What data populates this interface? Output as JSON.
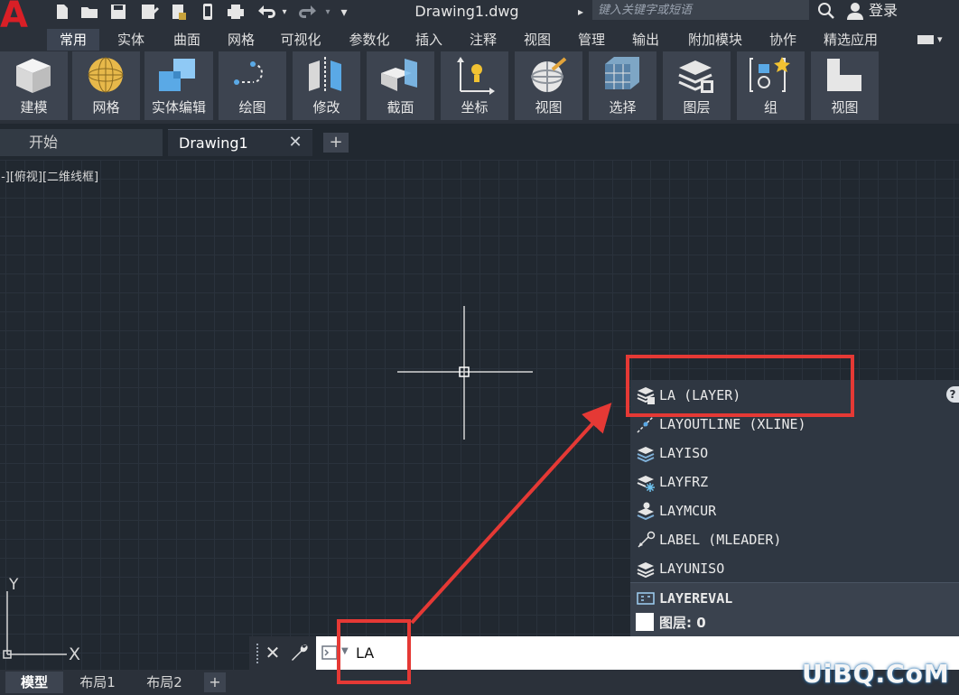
{
  "app": {
    "document_title": "Drawing1.dwg",
    "search_placeholder": "键入关键字或短语",
    "login_label": "登录",
    "logo_letter": "A",
    "accent_color": "#d91f26"
  },
  "ribbon_tabs": [
    {
      "label": "常用",
      "active": true
    },
    {
      "label": "实体"
    },
    {
      "label": "曲面"
    },
    {
      "label": "网格"
    },
    {
      "label": "可视化"
    },
    {
      "label": "参数化"
    },
    {
      "label": "插入"
    },
    {
      "label": "注释"
    },
    {
      "label": "视图"
    },
    {
      "label": "管理"
    },
    {
      "label": "输出"
    },
    {
      "label": "附加模块"
    },
    {
      "label": "协作"
    },
    {
      "label": "精选应用"
    }
  ],
  "ribbon_buttons": [
    {
      "label": "建模",
      "icon": "cube-icon"
    },
    {
      "label": "网格",
      "icon": "sphere-mesh-icon"
    },
    {
      "label": "实体编辑",
      "icon": "solid-edit-icon"
    },
    {
      "label": "绘图",
      "icon": "draw-icon"
    },
    {
      "label": "修改",
      "icon": "modify-icon"
    },
    {
      "label": "截面",
      "icon": "section-icon"
    },
    {
      "label": "坐标",
      "icon": "coordinates-icon"
    },
    {
      "label": "视图",
      "icon": "view-globe-icon"
    },
    {
      "label": "选择",
      "icon": "selection-icon"
    },
    {
      "label": "图层",
      "icon": "layers-icon"
    },
    {
      "label": "组",
      "icon": "group-icon"
    },
    {
      "label": "视图",
      "icon": "view-shape-icon"
    }
  ],
  "doc_tabs": [
    {
      "label": "开始",
      "active": false
    },
    {
      "label": "Drawing1",
      "active": true
    }
  ],
  "viewport_label": "[-][俯视][二维线框]",
  "ucs": {
    "x_label": "X",
    "y_label": "Y"
  },
  "autocomplete": {
    "items": [
      {
        "label": "LA (LAYER)",
        "icon": "layer-icon"
      },
      {
        "label": "LAYOUTLINE (XLINE)",
        "icon": "xline-icon"
      },
      {
        "label": "LAYISO",
        "icon": "layer-isolate-icon"
      },
      {
        "label": "LAYFRZ",
        "icon": "layer-freeze-icon"
      },
      {
        "label": "LAYMCUR",
        "icon": "layer-make-current-icon"
      },
      {
        "label": "LABEL (MLEADER)",
        "icon": "mleader-icon"
      },
      {
        "label": "LAYUNISO",
        "icon": "layer-unisolate-icon"
      },
      {
        "label": "LAYEREVAL",
        "icon": "layer-eval-icon"
      }
    ],
    "layer_row": "图层: 0",
    "help_glyph": "?"
  },
  "command_line": {
    "value": "LA"
  },
  "status_tabs": [
    {
      "label": "模型",
      "active": true
    },
    {
      "label": "布局1"
    },
    {
      "label": "布局2"
    }
  ],
  "watermark": "UiBQ.CoM",
  "annotation_color": "#e53935"
}
